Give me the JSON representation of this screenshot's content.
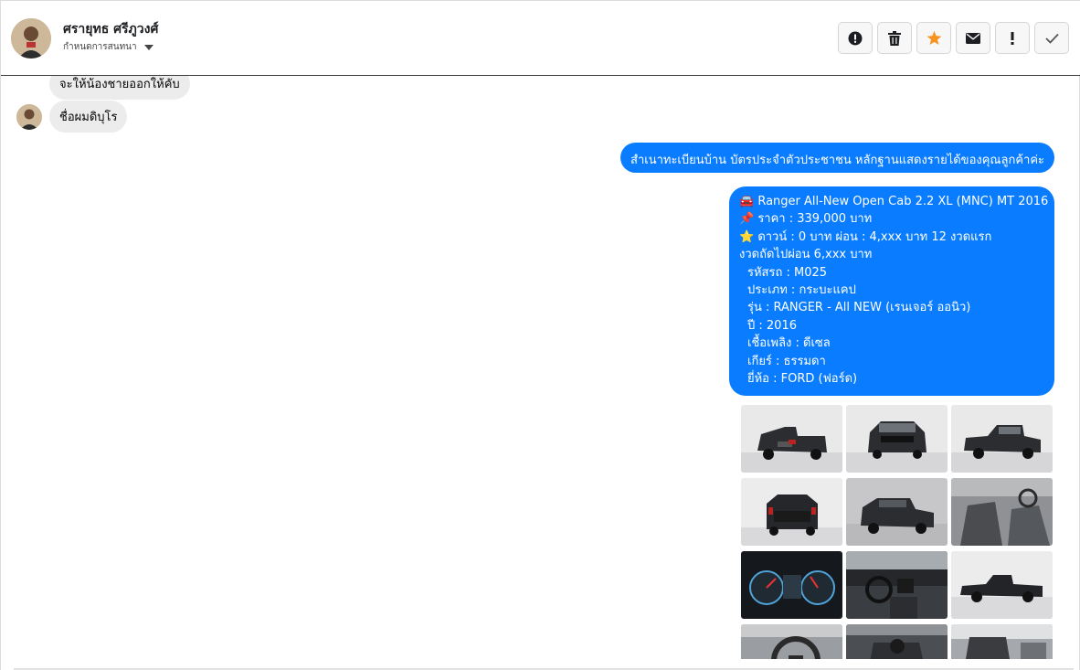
{
  "header": {
    "contact_name": "ศรายุทธ ศรีภูวงศ์",
    "subtitle": "กำหนดการสนทนา",
    "actions": [
      {
        "icon": "alert-circle-icon",
        "label": "report"
      },
      {
        "icon": "trash-icon",
        "label": "delete"
      },
      {
        "icon": "star-icon",
        "label": "favorite"
      },
      {
        "icon": "envelope-icon",
        "label": "mark-unread"
      },
      {
        "icon": "exclamation-icon",
        "label": "important"
      },
      {
        "icon": "check-icon",
        "label": "done"
      }
    ],
    "star_color": "#f7931e"
  },
  "messages": {
    "incoming_1": "จะให้น้องชายออกให้คับ",
    "incoming_2": "ชื่อผมดิบุโร",
    "outgoing_1": "สำเนาทะเบียนบ้าน  บัตรประจำตัวประชาชน  หลักฐานแสดงรายได้ของคุณลูกค้าค่ะ",
    "outgoing_2": {
      "lines": [
        "🚘 Ranger All-New Open Cab 2.2 XL (MNC) MT 2016",
        "📌 ราคา : 339,000 บาท",
        "⭐ ดาวน์ : 0 บาท ผ่อน : 4,xxx บาท 12 งวดแรก",
        "งวดถัดไปผ่อน  6,xxx บาท"
      ],
      "details": [
        "รหัสรถ : M025",
        "ประเภท : กระบะแคป",
        "รุ่น : RANGER - All NEW (เรนเจอร์ ออนิว)",
        "ปี : 2016",
        "เชื้อเพลิง : ดีเซล",
        "เกียร์ : ธรรมดา",
        "ยี่ห้อ : FORD (ฟอร์ด)"
      ]
    }
  },
  "colors": {
    "outgoing_bubble": "#0a7cff",
    "incoming_bubble": "#ececec"
  },
  "photos": [
    "truck-rear-three-quarter",
    "truck-front",
    "truck-front-three-quarter",
    "truck-rear",
    "truck-front-angle",
    "cabin-seats",
    "gauge-cluster",
    "dashboard",
    "truck-side",
    "steering-wheel",
    "gear-lever",
    "door-panel"
  ]
}
